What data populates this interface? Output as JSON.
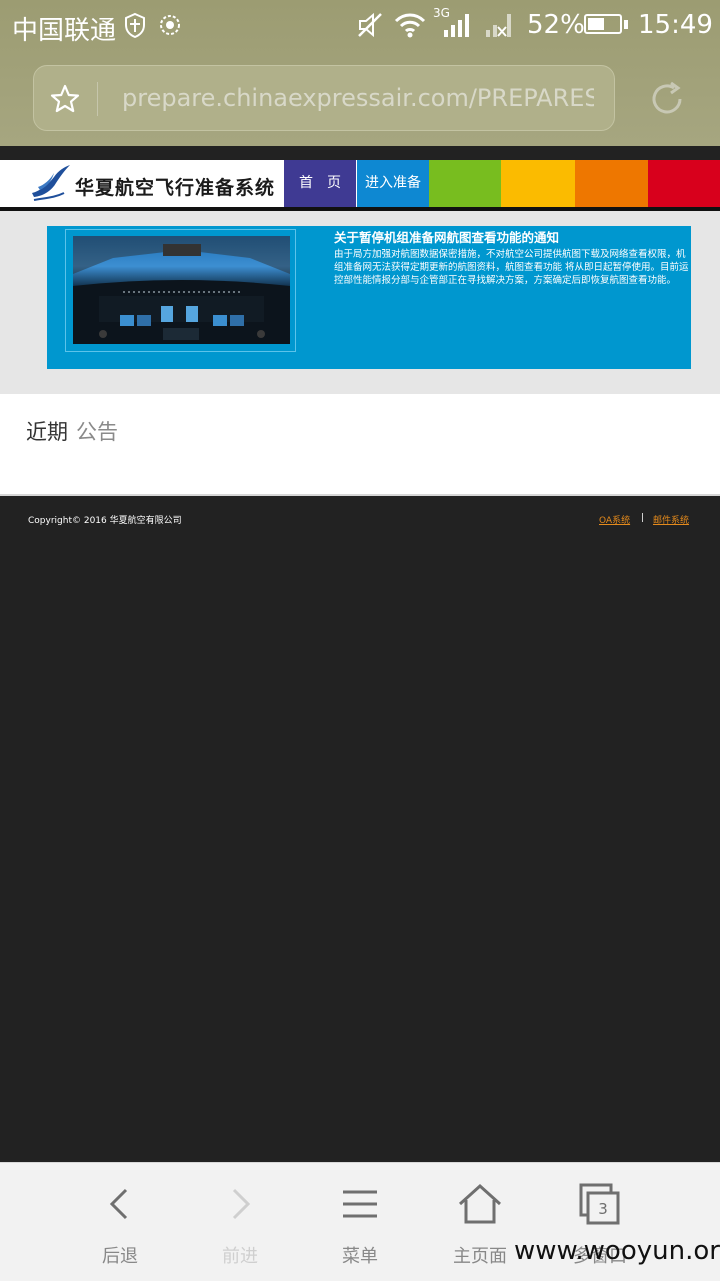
{
  "status_bar": {
    "carrier": "中国联通",
    "network": "3G",
    "battery_percent": "52%",
    "battery_level": 0.52,
    "time": "15:49"
  },
  "browser": {
    "url": "prepare.chinaexpressair.com/PREPARES",
    "bookmark_icon": "star-icon",
    "reload_icon": "reload-icon"
  },
  "site": {
    "logo_text": "华夏航空飞行准备系统",
    "nav": [
      {
        "label": "首　页",
        "color": "#3f3a93"
      },
      {
        "label": "进入准备",
        "color": "#0e88d2"
      },
      {
        "label": "",
        "color": "#78bd1f"
      },
      {
        "label": "",
        "color": "#fbbb00"
      },
      {
        "label": "",
        "color": "#ee7700"
      },
      {
        "label": "",
        "color": "#d8001c"
      }
    ]
  },
  "banner": {
    "title": "关于暂停机组准备网航图查看功能的通知",
    "body": "由于局方加强对航图数据保密措施，不对航空公司提供航图下载及网络查看权限，机组准备网无法获得定期更新的航图资料，航图查看功能 将从即日起暂停使用。目前运控部性能情报分部与企管部正在寻找解决方案，方案确定后即恢复航图查看功能。"
  },
  "announcements": {
    "heading_a": "近期",
    "heading_b": "公告"
  },
  "footer": {
    "copyright": "Copyright© 2016 华夏航空有限公司",
    "links": [
      "OA系统",
      "邮件系统"
    ],
    "separator": "|"
  },
  "toolbar": {
    "items": [
      {
        "label": "后退",
        "icon": "back-icon",
        "enabled": true
      },
      {
        "label": "前进",
        "icon": "forward-icon",
        "enabled": false
      },
      {
        "label": "菜单",
        "icon": "menu-icon",
        "enabled": true
      },
      {
        "label": "主页面",
        "icon": "home-icon",
        "enabled": true
      },
      {
        "label": "多窗口",
        "icon": "tabs-icon",
        "enabled": true,
        "count": "3"
      }
    ]
  },
  "watermark": "www.wooyun.org"
}
